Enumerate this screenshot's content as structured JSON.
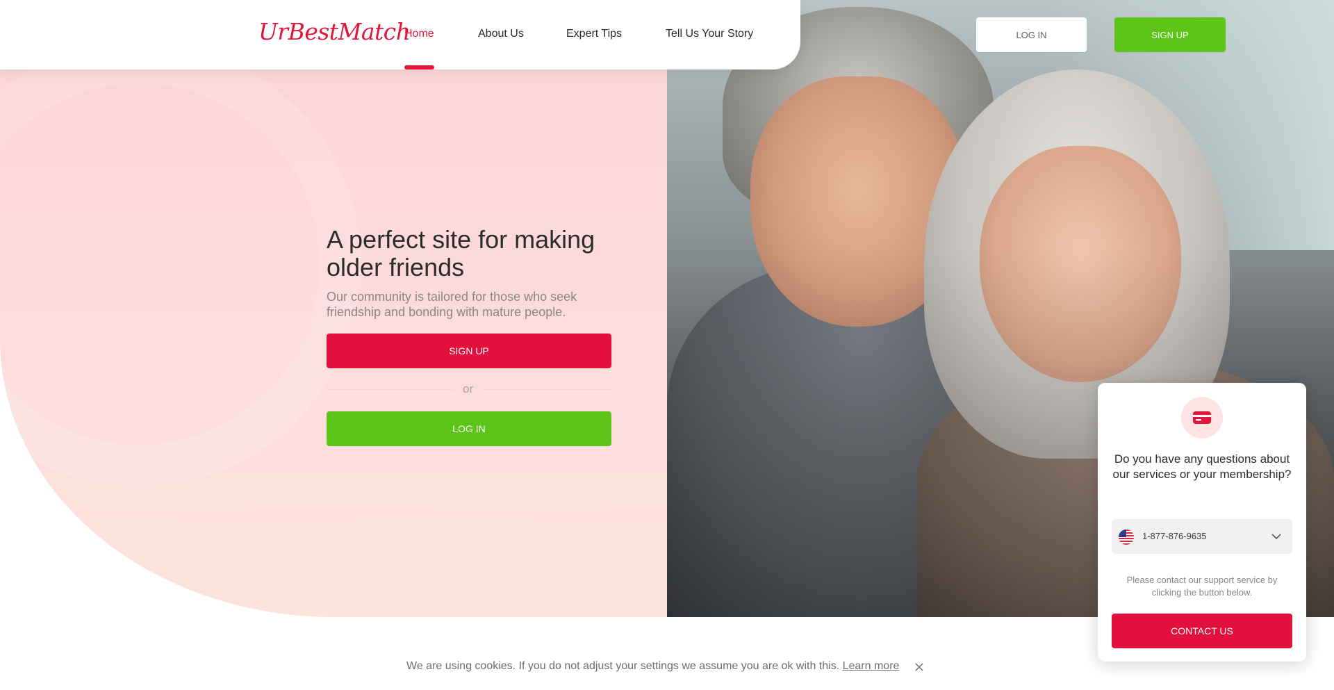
{
  "brand": {
    "logo_text": "UrBestMatch",
    "accent": "#e3163a",
    "green": "#5dc51a"
  },
  "nav": {
    "items": [
      {
        "label": "Home",
        "active": true
      },
      {
        "label": "About Us",
        "active": false
      },
      {
        "label": "Expert Tips",
        "active": false
      },
      {
        "label": "Tell Us Your Story",
        "active": false
      }
    ],
    "login_label": "LOG IN",
    "signup_label": "SIGN UP"
  },
  "hero": {
    "title": "A perfect site for making older friends",
    "subtitle": "Our community is tailored for those who seek friendship and bonding with mature people.",
    "signup_label": "SIGN UP",
    "or_label": "or",
    "login_label": "LOG IN"
  },
  "support": {
    "icon": "credit-card-icon",
    "title": "Do you have any questions about our services or your membership?",
    "phone": "1-877-876-9635",
    "phone_flag": "us-flag-icon",
    "note": "Please contact our support service by clicking the button below.",
    "contact_label": "CONTACT US"
  },
  "cookie": {
    "text": "We are using cookies. If you do not adjust your settings we assume you are ok with this.",
    "link_label": "Learn more"
  }
}
